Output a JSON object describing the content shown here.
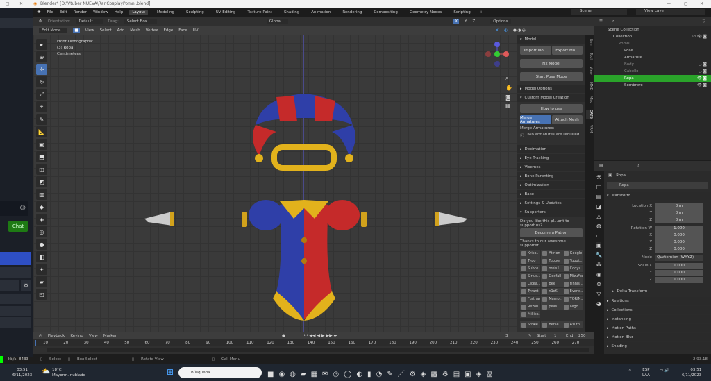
{
  "window": {
    "title": "Blender* [D:\\Vtuber NUEVA\\RanCosplayPomni.blend]",
    "minimize": "—",
    "maximize": "▢",
    "close": "✕"
  },
  "menu": [
    "File",
    "Edit",
    "Render",
    "Window",
    "Help"
  ],
  "workspaces": [
    "Layout",
    "Modeling",
    "Sculpting",
    "UV Editing",
    "Texture Paint",
    "Shading",
    "Animation",
    "Rendering",
    "Compositing",
    "Geometry Nodes",
    "Scripting"
  ],
  "scene": "Scene",
  "view_layer": "View Layer",
  "header1": {
    "orientation_label": "Orientation:",
    "orientation": "Default",
    "drag_label": "Drag:",
    "drag": "Select Box",
    "transform": "Global",
    "options": "Options",
    "axes": [
      "X",
      "Y",
      "Z"
    ]
  },
  "header2": {
    "mode": "Edit Mode",
    "menus": [
      "View",
      "Select",
      "Add",
      "Mesh",
      "Vertex",
      "Edge",
      "Face",
      "UV"
    ]
  },
  "overlay": {
    "view": "Front Orthographic",
    "object": "(3) Ropa",
    "units": "Centimeters"
  },
  "npanel": {
    "model": "Model",
    "import": "Import Mo...",
    "export": "Export Mo...",
    "fix": "Fix Model",
    "pose": "Start Pose Mode",
    "model_options": "Model Options",
    "custom": "Custom Model Creation",
    "how": "How to use",
    "merge": "Merge Armatures",
    "attach": "Attach Mesh",
    "merge_label": "Merge Armatures:",
    "warning": "Two armatures are required!",
    "sections": [
      "Decimation",
      "Eye Tracking",
      "Visemes",
      "Bone Parenting",
      "Optimization",
      "Bake",
      "Settings & Updates"
    ],
    "supporters": "Supporters",
    "support_q": "Do you like this pl...ant to support us?",
    "patron": "Become a Patron",
    "thanks": "Thanks to our awesome supporter...",
    "names": [
      "Kriso...",
      "Atirion",
      "Google",
      "Typo",
      "Tupper",
      "Tuppi...",
      "Subco...",
      "oreis1",
      "Codys...",
      "Sirius...",
      "Godfall",
      "MizuFox",
      "Cicea...",
      "Bee",
      "Finnis...",
      "Tyrant",
      "n1cK",
      "Evend...",
      "Furtrap",
      "Mamo...",
      "TORIN...",
      "Rezob...",
      "peas",
      "Lego...",
      "Millica...",
      "Str4le",
      "Berse...",
      "Azuth"
    ]
  },
  "ntabs": [
    "Item",
    "Tool",
    "View",
    "MMD",
    "Misc",
    "CATS",
    "VRM"
  ],
  "outliner": {
    "root": "Scene Collection",
    "items": [
      "Collection",
      "Pomni",
      "Pose",
      "Armature",
      "Body",
      "Cabello",
      "Ropa",
      "Sombrero"
    ]
  },
  "properties": {
    "object": "Ropa",
    "data": "Ropa",
    "transform": "Transform",
    "rows": [
      [
        "Location X",
        "0 m"
      ],
      [
        "Y",
        "0 m"
      ],
      [
        "Z",
        "0 m"
      ],
      [
        "Rotation W",
        "1.000"
      ],
      [
        "X",
        "0.000"
      ],
      [
        "Y",
        "0.000"
      ],
      [
        "Z",
        "0.000"
      ],
      [
        "Mode",
        "Quaternion (WXYZ)"
      ],
      [
        "Scale X",
        "1.000"
      ],
      [
        "Y",
        "1.000"
      ],
      [
        "Z",
        "1.000"
      ]
    ],
    "delta": "Delta Transform",
    "sections": [
      "Relations",
      "Collections",
      "Instancing",
      "Motion Paths",
      "Motion Blur",
      "Shading"
    ]
  },
  "timeline": {
    "menus": [
      "Playback",
      "Keying",
      "View",
      "Marker"
    ],
    "frame": "3",
    "start_label": "Start",
    "start": "1",
    "end_label": "End",
    "end": "250",
    "ticks": [
      "10",
      "20",
      "30",
      "40",
      "50",
      "60",
      "70",
      "80",
      "90",
      "100",
      "110",
      "120",
      "130",
      "140",
      "150",
      "160",
      "170",
      "180",
      "190",
      "200",
      "210",
      "220",
      "230",
      "240",
      "250",
      "260",
      "270"
    ]
  },
  "status": {
    "select": "Select",
    "box": "Box Select",
    "rotate": "Rotate View",
    "call": "Call Menu",
    "version": "2.93.18"
  },
  "leftapp": {
    "chat": "Chat",
    "kbps": "kb/s: 8433"
  },
  "taskbar": {
    "time": "03:51",
    "date": "6/11/2023",
    "temp": "18°C",
    "weather": "Mayorm. nublado",
    "search": "Búsqueda",
    "lang": "ESP",
    "layout": "LAA"
  }
}
